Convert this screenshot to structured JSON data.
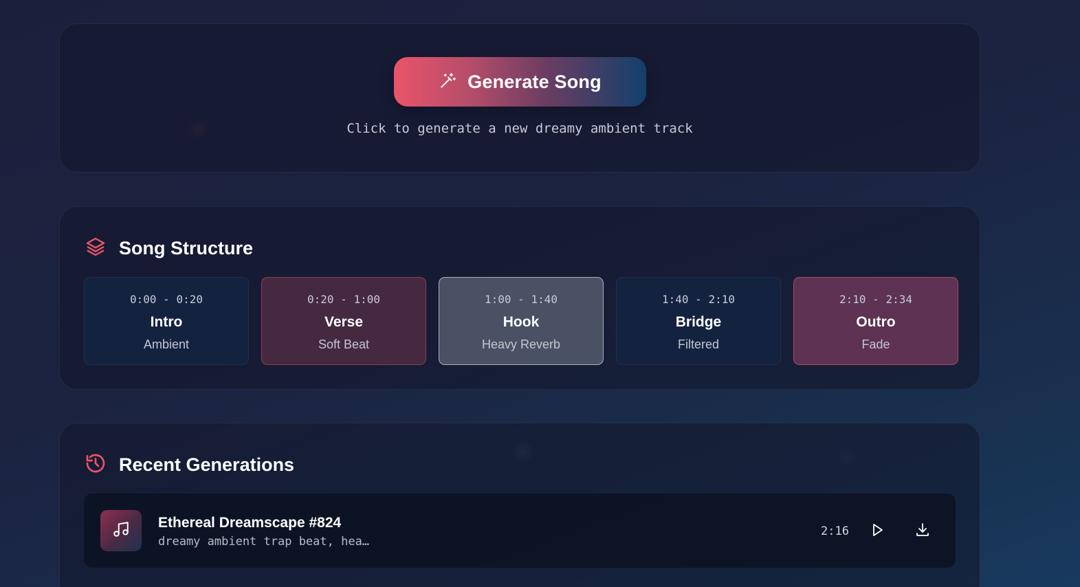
{
  "generate": {
    "button_label": "Generate Song",
    "button_icon": "magic-wand-icon",
    "hint": "Click to generate a new dreamy ambient track"
  },
  "structure": {
    "title": "Song Structure",
    "icon": "layers-icon",
    "sections": [
      {
        "time": "0:00 - 0:20",
        "name": "Intro",
        "desc": "Ambient"
      },
      {
        "time": "0:20 - 1:00",
        "name": "Verse",
        "desc": "Soft Beat"
      },
      {
        "time": "1:00 - 1:40",
        "name": "Hook",
        "desc": "Heavy Reverb"
      },
      {
        "time": "1:40 - 2:10",
        "name": "Bridge",
        "desc": "Filtered"
      },
      {
        "time": "2:10 - 2:34",
        "name": "Outro",
        "desc": "Fade"
      }
    ]
  },
  "recent": {
    "title": "Recent Generations",
    "icon": "history-icon",
    "tracks": [
      {
        "title": "Ethereal Dreamscape #824",
        "prompt": "dreamy ambient trap beat, hea…",
        "duration": "2:16",
        "icon": "music-note-icon"
      }
    ]
  },
  "colors": {
    "accent": "#ea5469",
    "accent_blue": "#12406b",
    "background": "#1c1f3c"
  }
}
